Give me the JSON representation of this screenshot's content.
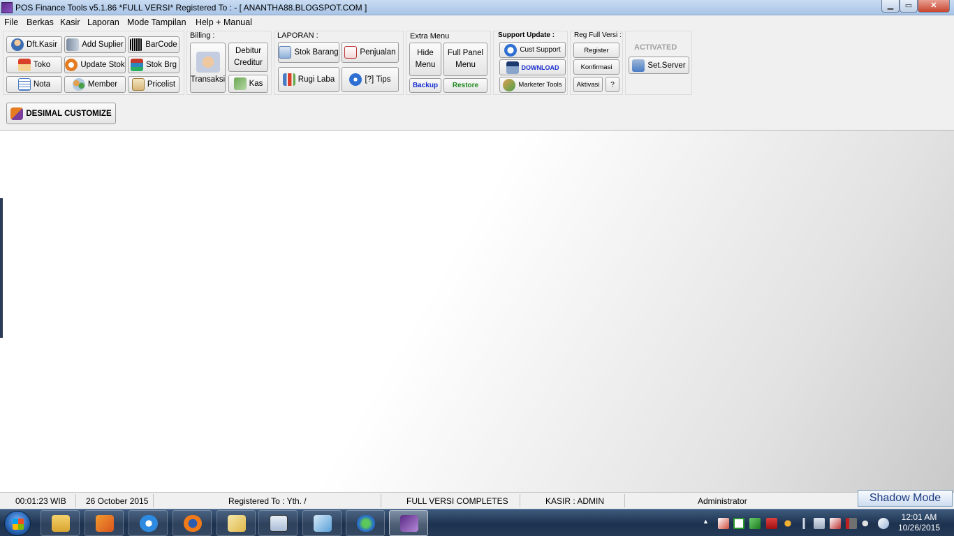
{
  "window": {
    "title": "POS Finance Tools v5.1.86 *FULL VERSI* Registered To :  -   [ ANANTHA88.BLOGSPOT.COM ]",
    "min_glyph": "▁",
    "max_glyph": "▭",
    "close_glyph": "✕"
  },
  "menu": [
    "File",
    "Berkas",
    "Kasir",
    "Laporan",
    "Mode Tampilan",
    "Help + Manual"
  ],
  "master": {
    "dft_kasir": "Dft.Kasir",
    "add_suplier": "Add Suplier",
    "barcode": "BarCode",
    "toko": "Toko",
    "update_stok": "Update Stok",
    "stok_brg": "Stok Brg",
    "nota": "Nota",
    "member": "Member",
    "pricelist": "Pricelist"
  },
  "billing": {
    "label": "Billing :",
    "transaksi": "Transaksi",
    "debitur_line1": "Debitur",
    "debitur_line2": "Creditur",
    "kas": "Kas"
  },
  "laporan": {
    "label": "LAPORAN :",
    "stok_barang": "Stok Barang",
    "penjualan": "Penjualan",
    "rugi_laba": "Rugi Laba",
    "tips": "[?] Tips"
  },
  "extra": {
    "label": "Extra Menu",
    "hide_line1": "Hide",
    "hide_line2": "Menu",
    "full_line1": "Full Panel",
    "full_line2": "Menu",
    "backup": "Backup",
    "restore": "Restore"
  },
  "support": {
    "label": "Support Update :",
    "cust_support": "Cust Support",
    "download": "DOWNLOAD",
    "marketer_tools": "Marketer Tools"
  },
  "reg": {
    "label": "Reg Full Versi :",
    "register": "Register",
    "konfirmasi": "Konfirmasi",
    "aktivasi": "Aktivasi",
    "help": "?"
  },
  "server": {
    "activated": "ACTIVATED",
    "set_server": "Set.Server"
  },
  "desimal": "DESIMAL CUSTOMIZE",
  "status": {
    "time": "00:01:23 WIB",
    "date": "26 October 2015",
    "registered": "Registered To : Yth. /",
    "version": "FULL VERSI COMPLETES",
    "kasir": "KASIR : ADMIN",
    "role": "Administrator",
    "shadow_mode": "Shadow Mode"
  },
  "taskbar": {
    "clock_time": "12:01 AM",
    "clock_date": "10/26/2015",
    "tray_arrow": "▲"
  },
  "colors": {
    "backup": "#1a2fd0",
    "restore": "#1e8a1e",
    "download": "#1a2fd0"
  }
}
